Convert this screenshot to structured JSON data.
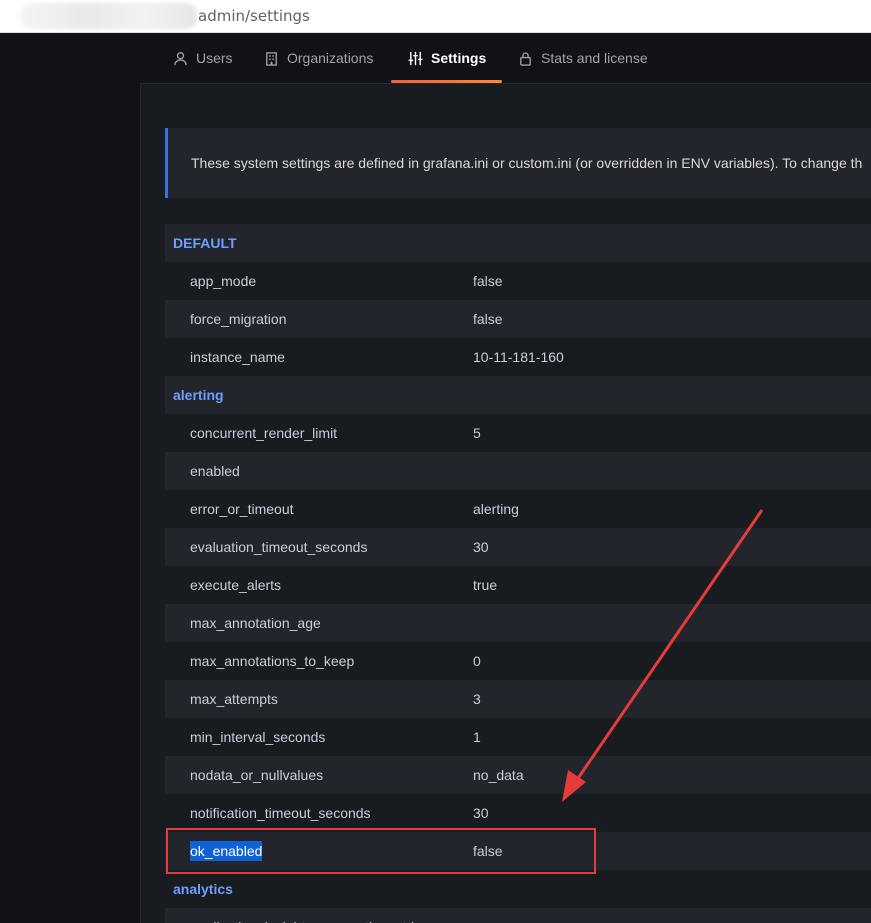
{
  "browser": {
    "url": "admin/settings"
  },
  "tabs": [
    {
      "label": "Users",
      "icon": "user-icon"
    },
    {
      "label": "Organizations",
      "icon": "building-icon"
    },
    {
      "label": "Settings",
      "icon": "sliders-icon",
      "active": true
    },
    {
      "label": "Stats and license",
      "icon": "lock-icon"
    }
  ],
  "info_text": "These system settings are defined in grafana.ini or custom.ini (or overridden in ENV variables). To change th",
  "sections": [
    {
      "name": "DEFAULT",
      "rows": [
        {
          "key": "app_mode",
          "value": "false"
        },
        {
          "key": "force_migration",
          "value": "false"
        },
        {
          "key": "instance_name",
          "value": "10-11-181-160"
        }
      ]
    },
    {
      "name": "alerting",
      "rows": [
        {
          "key": "concurrent_render_limit",
          "value": "5"
        },
        {
          "key": "enabled",
          "value": ""
        },
        {
          "key": "error_or_timeout",
          "value": "alerting"
        },
        {
          "key": "evaluation_timeout_seconds",
          "value": "30"
        },
        {
          "key": "execute_alerts",
          "value": "true"
        },
        {
          "key": "max_annotation_age",
          "value": ""
        },
        {
          "key": "max_annotations_to_keep",
          "value": "0"
        },
        {
          "key": "max_attempts",
          "value": "3"
        },
        {
          "key": "min_interval_seconds",
          "value": "1"
        },
        {
          "key": "nodata_or_nullvalues",
          "value": "no_data"
        },
        {
          "key": "notification_timeout_seconds",
          "value": "30"
        },
        {
          "key": "ok_enabled",
          "value": "false",
          "selected": true
        }
      ]
    },
    {
      "name": "analytics",
      "rows": [
        {
          "key": "application_insights_connection_string",
          "value": ""
        }
      ]
    }
  ],
  "colors": {
    "accent": "#6e9fff",
    "highlight_box": "#e53b3b",
    "selection": "#0e62d6"
  }
}
